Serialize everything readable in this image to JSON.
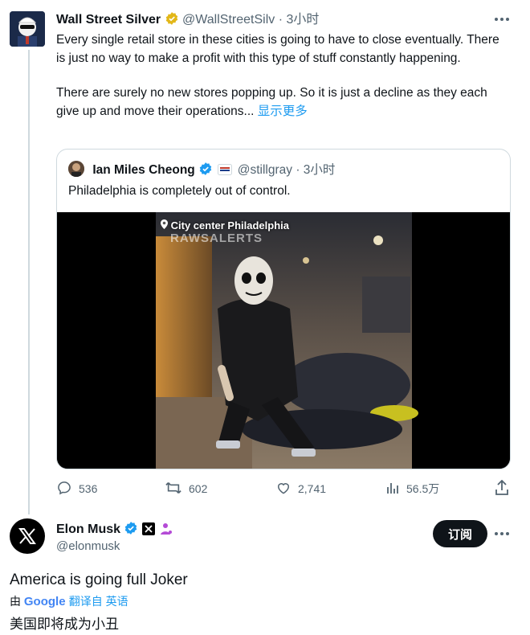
{
  "tweet": {
    "author_name": "Wall Street Silver",
    "handle": "@WallStreetSilv",
    "dot": "·",
    "time": "3小时",
    "paragraph1": "Every single retail store in these cities is going to have to close eventually. There is just no way to make a profit with this type of stuff constantly happening.",
    "paragraph2": "There are surely no new stores popping up. So it is just a decline as they each give up and move their operations... ",
    "show_more": "显示更多",
    "more_icon": "more-horizontal-icon"
  },
  "quote": {
    "author_name": "Ian Miles Cheong",
    "handle": "@stillgray",
    "dot": "·",
    "time": "3小时",
    "text": "Philadelphia is completely out of control.",
    "video_location": "City center Philadelphia",
    "video_watermark": "RAWSALERTS"
  },
  "actions": {
    "replies": "536",
    "reposts": "602",
    "likes": "2,741",
    "views": "56.5万"
  },
  "reply": {
    "author_name": "Elon Musk",
    "handle": "@elonmusk",
    "follow_label": "订阅",
    "text": "America is going full Joker",
    "translate_by": "由",
    "translate_brand": "Google",
    "translate_action": "翻译自 英语",
    "translated_text": "美国即将成为小丑"
  },
  "colors": {
    "accent": "#1d9bf0",
    "verified_gold": "#e2b719",
    "text_primary": "#0f1419",
    "text_secondary": "#536471",
    "border": "#cfd9de"
  }
}
